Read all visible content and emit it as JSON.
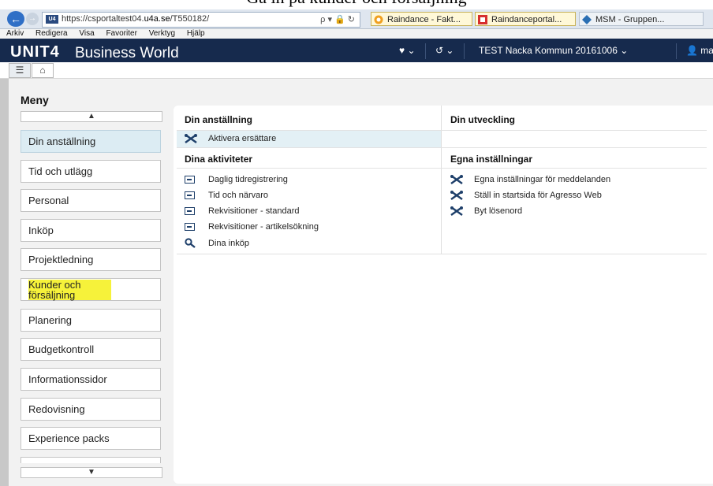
{
  "caption": "Gå in på kunder och försäljning",
  "browser": {
    "back_icon": "back-arrow-icon",
    "forward_icon": "forward-arrow-icon",
    "favicon_text": "U4",
    "url_prefix": "https://csportaltest04.",
    "url_domain": "u4a.se",
    "url_path": "/T550182/",
    "address_icons": "ρ ▾ 🔒 ↻",
    "tabs": [
      {
        "label": "Raindance - Fakt...",
        "icon": "raindance-icon"
      },
      {
        "label": "Raindanceportal...",
        "icon": "raindanceportal-icon"
      },
      {
        "label": "MSM - Gruppen...",
        "icon": "msm-icon"
      }
    ]
  },
  "menu_bar": [
    "Arkiv",
    "Redigera",
    "Visa",
    "Favoriter",
    "Verktyg",
    "Hjälp"
  ],
  "app": {
    "logo": "UNIT4",
    "name": "Business World",
    "favorites_icon": "heart-icon",
    "history_icon": "history-icon",
    "company": "TEST Nacka Kommun 20161006",
    "user_icon": "user-icon",
    "user_fragment": "ma"
  },
  "toolbar": {
    "menu_icon": "menu-list-icon",
    "home_icon": "home-icon"
  },
  "sidebar": {
    "title": "Meny",
    "up_arrow": "▲",
    "down_arrow": "▼",
    "items": [
      {
        "label": "Din anställning"
      },
      {
        "label": "Tid och utlägg"
      },
      {
        "label": "Personal"
      },
      {
        "label": "Inköp"
      },
      {
        "label": "Projektledning"
      },
      {
        "label": "Kunder och försäljning"
      },
      {
        "label": "Planering"
      },
      {
        "label": "Budgetkontroll"
      },
      {
        "label": "Informationssidor"
      },
      {
        "label": "Redovisning"
      },
      {
        "label": "Experience packs"
      }
    ]
  },
  "main": {
    "left_col": {
      "heading": "Din anställning",
      "items": [
        {
          "label": "Aktivera ersättare",
          "icon": "tools-icon"
        }
      ],
      "activities_heading": "Dina aktiviteter",
      "activities": [
        {
          "label": "Daglig tidregistrering",
          "icon": "form-icon"
        },
        {
          "label": "Tid och närvaro",
          "icon": "form-icon"
        },
        {
          "label": "Rekvisitioner - standard",
          "icon": "form-icon"
        },
        {
          "label": "Rekvisitioner - artikelsökning",
          "icon": "form-icon"
        },
        {
          "label": "Dina inköp",
          "icon": "search-icon"
        }
      ]
    },
    "right_col": {
      "heading": "Din utveckling",
      "settings_heading": "Egna inställningar",
      "settings": [
        {
          "label": "Egna inställningar för meddelanden",
          "icon": "tools-icon"
        },
        {
          "label": "Ställ in startsida för Agresso Web",
          "icon": "tools-icon"
        },
        {
          "label": "Byt lösenord",
          "icon": "tools-icon"
        }
      ]
    }
  },
  "colors": {
    "header_bg": "#162a4d",
    "selected_item": "#dcecf3",
    "highlight": "#f6f23a"
  }
}
